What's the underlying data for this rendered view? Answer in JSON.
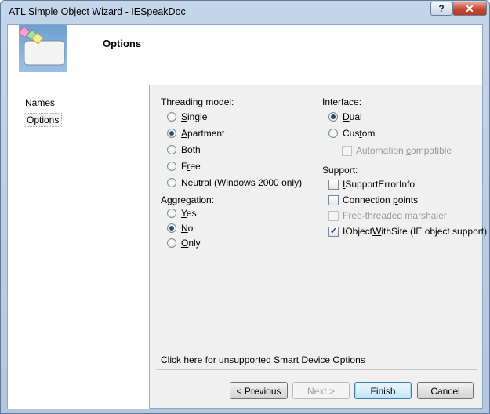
{
  "window": {
    "title": "ATL Simple Object Wizard - IESpeakDoc",
    "help_label": "?",
    "close_label": "✕"
  },
  "header": {
    "title": "Options",
    "icon": "wizard-window-icon"
  },
  "sidebar": {
    "items": [
      {
        "label": "Names"
      },
      {
        "label": "Options"
      }
    ]
  },
  "threading": {
    "label": "Threading model:",
    "options": [
      {
        "pre": "",
        "ul": "S",
        "post": "ingle"
      },
      {
        "pre": "",
        "ul": "A",
        "post": "partment"
      },
      {
        "pre": "",
        "ul": "B",
        "post": "oth"
      },
      {
        "pre": "F",
        "ul": "r",
        "post": "ee"
      },
      {
        "pre": "Neu",
        "ul": "t",
        "post": "ral (Windows 2000 only)"
      }
    ]
  },
  "aggregation": {
    "label": "Aggregation:",
    "options": [
      {
        "pre": "",
        "ul": "Y",
        "post": "es"
      },
      {
        "pre": "",
        "ul": "N",
        "post": "o"
      },
      {
        "pre": "",
        "ul": "O",
        "post": "nly"
      }
    ]
  },
  "interface": {
    "label": "Interface:",
    "options": [
      {
        "pre": "",
        "ul": "D",
        "post": "ual"
      },
      {
        "pre": "Cus",
        "ul": "t",
        "post": "om"
      }
    ],
    "automation": {
      "pre": "Automation ",
      "ul": "c",
      "post": "ompatible"
    }
  },
  "support": {
    "label": "Support:",
    "items": [
      {
        "pre": "",
        "ul": "I",
        "post": "SupportErrorInfo"
      },
      {
        "pre": "Connection ",
        "ul": "p",
        "post": "oints"
      },
      {
        "pre": "Free-threaded ",
        "ul": "m",
        "post": "arshaler"
      },
      {
        "pre": "IObject",
        "ul": "W",
        "post": "ithSite (IE object support)"
      }
    ],
    "check_mark": "✓"
  },
  "smart_device_link": "Click here for unsupported Smart Device Options",
  "buttons": {
    "previous": "< Previous",
    "next": "Next >",
    "finish": "Finish",
    "cancel": "Cancel"
  }
}
